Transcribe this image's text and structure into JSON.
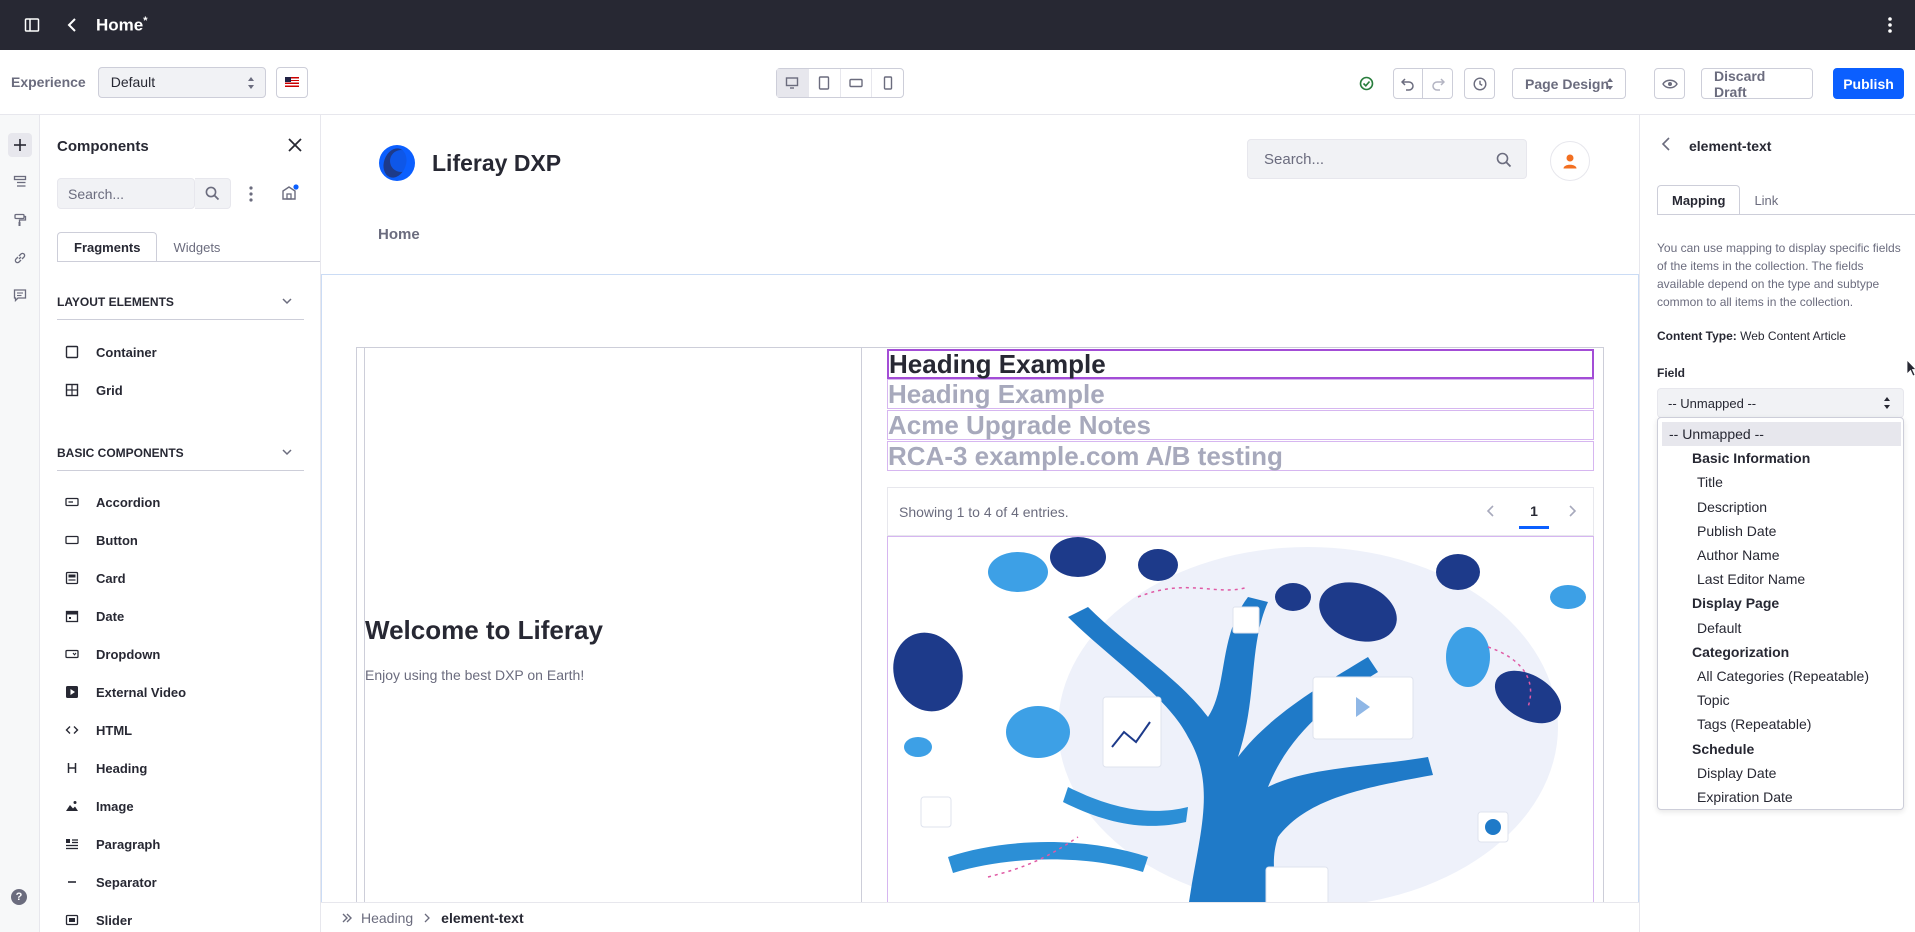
{
  "topbar": {
    "title": "Home",
    "modified_marker": "*"
  },
  "toolbar": {
    "experience_label": "Experience",
    "experience_value": "Default",
    "page_design_label": "Page Design",
    "discard_label": "Discard Draft",
    "publish_label": "Publish",
    "colors": {
      "primary": "#0b5fff",
      "success": "#287d3c"
    }
  },
  "components_panel": {
    "title": "Components",
    "search_placeholder": "Search...",
    "tabs": [
      "Fragments",
      "Widgets"
    ],
    "layout_section": "LAYOUT ELEMENTS",
    "layout_items": [
      "Container",
      "Grid"
    ],
    "basic_section": "BASIC COMPONENTS",
    "basic_items": [
      "Accordion",
      "Button",
      "Card",
      "Date",
      "Dropdown",
      "External Video",
      "HTML",
      "Heading",
      "Image",
      "Paragraph",
      "Separator",
      "Slider"
    ]
  },
  "rail": {
    "help": "?"
  },
  "canvas": {
    "site_name": "Liferay DXP",
    "search_placeholder": "Search...",
    "nav_home": "Home",
    "welcome_title": "Welcome to Liferay",
    "welcome_sub": "Enjoy using the best DXP on Earth!",
    "collection_items": [
      "Heading Example",
      "Heading Example",
      "Acme Upgrade Notes",
      "RCA-3 example.com A/B testing"
    ],
    "showing": "Showing 1 to 4 of 4 entries.",
    "current_page": "1"
  },
  "breadcrumb": {
    "parent": "Heading",
    "current": "element-text"
  },
  "config_panel": {
    "title": "element-text",
    "tabs": [
      "Mapping",
      "Link"
    ],
    "description": "You can use mapping to display specific fields of the items in the collection. The fields available depend on the type and subtype common to all items in the collection.",
    "content_type_label": "Content Type:",
    "content_type_value": "Web Content Article",
    "field_label": "Field",
    "field_value": "-- Unmapped --",
    "options": [
      {
        "label": "-- Unmapped --",
        "kind": "selected"
      },
      {
        "label": "Basic Information",
        "kind": "group"
      },
      {
        "label": "Title",
        "kind": "leaf"
      },
      {
        "label": "Description",
        "kind": "leaf"
      },
      {
        "label": "Publish Date",
        "kind": "leaf"
      },
      {
        "label": "Author Name",
        "kind": "leaf"
      },
      {
        "label": "Last Editor Name",
        "kind": "leaf"
      },
      {
        "label": "Display Page",
        "kind": "group"
      },
      {
        "label": "Default",
        "kind": "leaf"
      },
      {
        "label": "Categorization",
        "kind": "group"
      },
      {
        "label": "All Categories (Repeatable)",
        "kind": "leaf"
      },
      {
        "label": "Topic",
        "kind": "leaf"
      },
      {
        "label": "Tags (Repeatable)",
        "kind": "leaf"
      },
      {
        "label": "Schedule",
        "kind": "group"
      },
      {
        "label": "Display Date",
        "kind": "leaf"
      },
      {
        "label": "Expiration Date",
        "kind": "leaf"
      }
    ]
  }
}
